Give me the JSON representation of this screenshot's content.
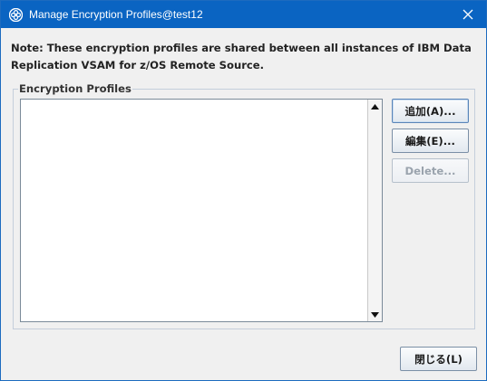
{
  "window": {
    "title": "Manage Encryption Profiles@test12",
    "app_icon": "app-logo-icon",
    "close_icon": "close-icon",
    "titlebar_color": "#0a64c2"
  },
  "note": {
    "text": "Note: These encryption profiles are shared between all instances of IBM Data Replication VSAM for z/OS Remote Source."
  },
  "profiles_group": {
    "title": "Encryption Profiles",
    "items": []
  },
  "buttons": {
    "add_label": "追加(A)...",
    "edit_label": "編集(E)...",
    "delete_label": "Delete...",
    "close_label": "閉じる(L)"
  },
  "scrollbar": {
    "up_icon": "scroll-up-arrow-icon",
    "down_icon": "scroll-down-arrow-icon"
  }
}
